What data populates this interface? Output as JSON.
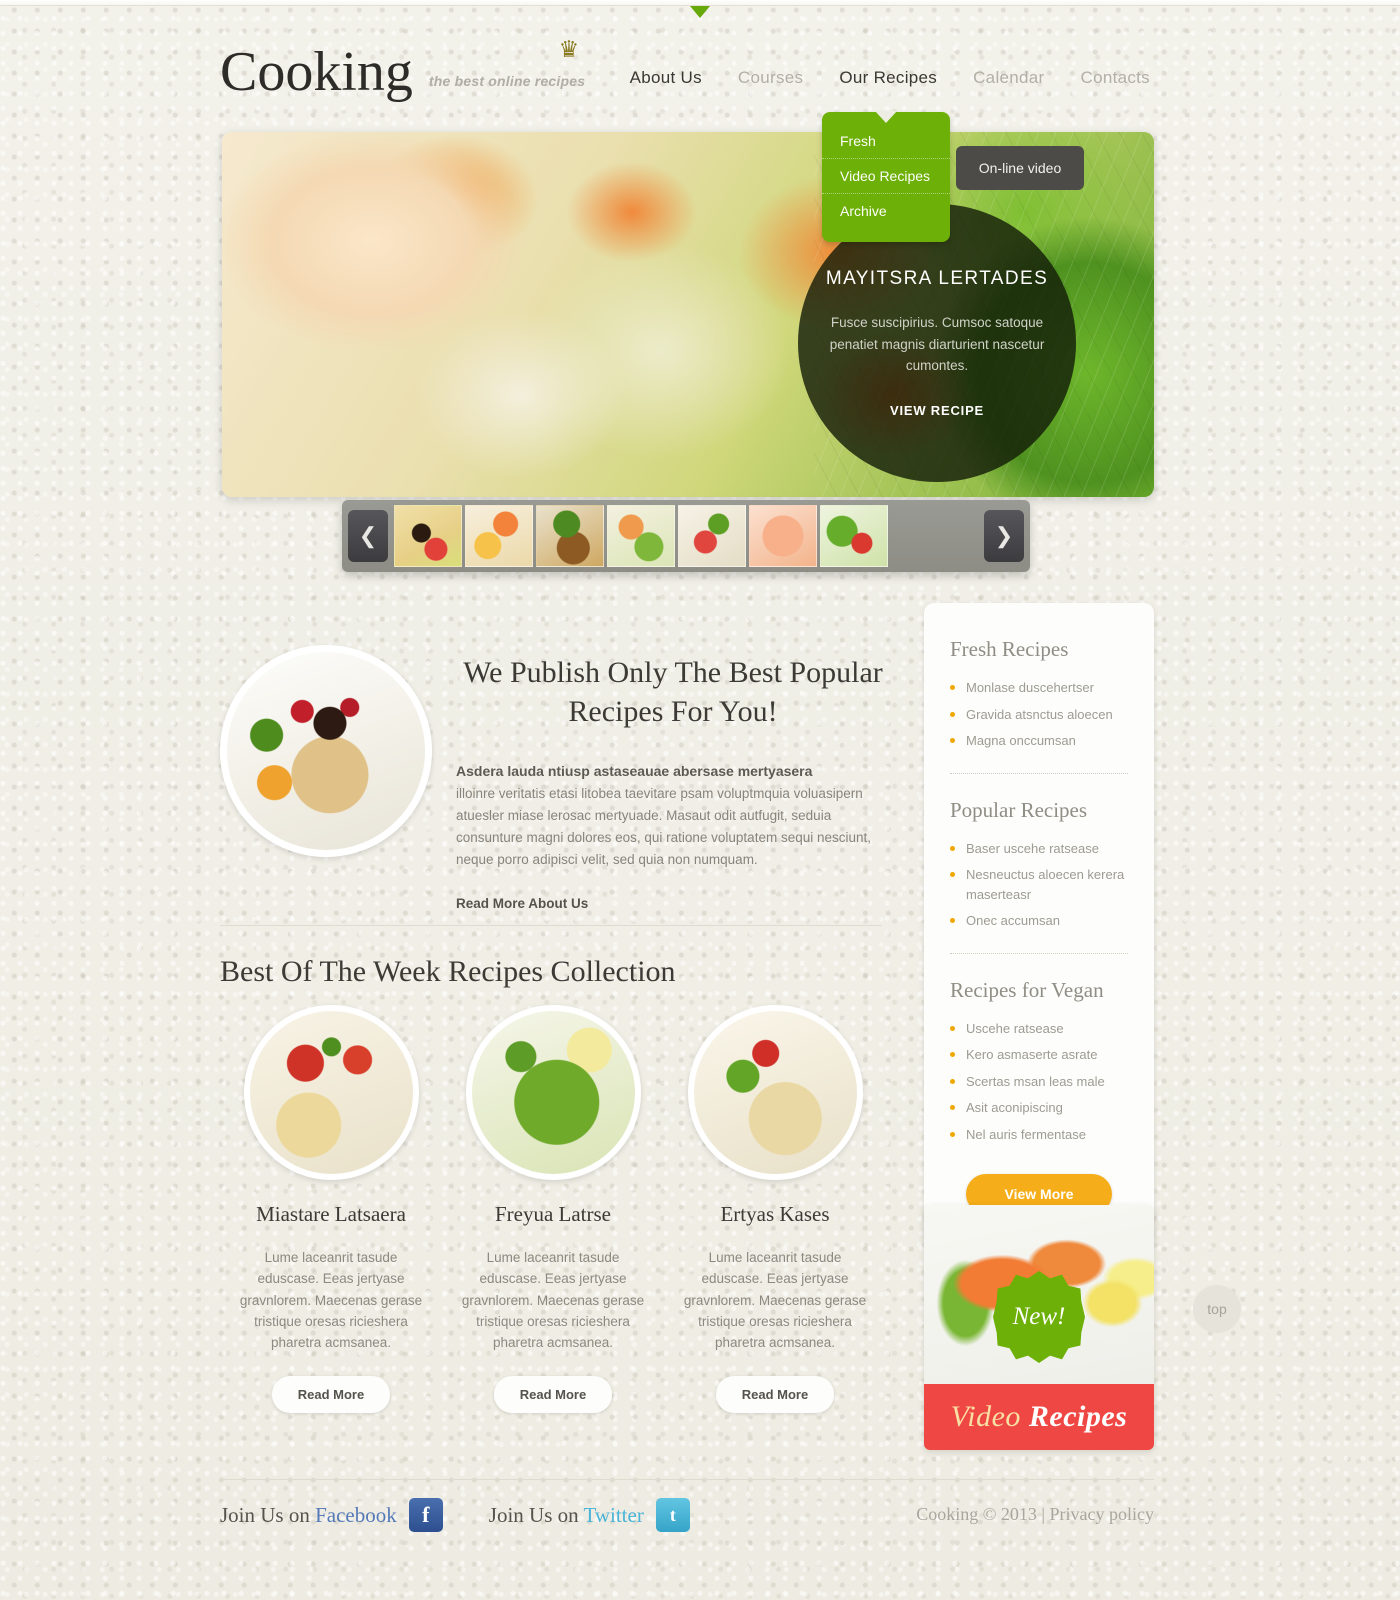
{
  "brand": {
    "name": "Cooking",
    "tagline": "the best online recipes",
    "crown_icon": "crown-icon"
  },
  "nav": {
    "items": [
      {
        "label": "About Us",
        "active": true
      },
      {
        "label": "Courses",
        "active": false
      },
      {
        "label": "Our Recipes",
        "active": true
      },
      {
        "label": "Calendar",
        "active": false
      },
      {
        "label": "Contacts",
        "active": false
      }
    ],
    "dropdown": {
      "items": [
        "Fresh",
        "Video Recipes",
        "Archive"
      ]
    },
    "flyout": {
      "label": "On-line video"
    }
  },
  "hero": {
    "title": "MAYITSRA LERTADES",
    "description": "Fusce suscipirius. Cumsoc satoque penatiet magnis diarturient nascetur cumontes.",
    "cta": "VIEW RECIPE"
  },
  "carousel": {
    "prev_icon": "chevron-left-icon",
    "next_icon": "chevron-right-icon",
    "thumb_count": 7
  },
  "about": {
    "heading": "We Publish Only The Best Popular Recipes For You!",
    "lead": "Asdera lauda ntiusp astaseauae abersase mertyasera",
    "body": "illoinre veritatis etasi litobea taevitare psam voluptmquia voluasipern atuesler miase lerosac mertyuade. Masaut odit autfugit, seduia consunture magni dolores eos, qui ratione voluptatem sequi nesciunt, neque porro adipisci velit, sed quia non numquam.",
    "link": "Read More About Us"
  },
  "week": {
    "title": "Best Of The Week Recipes Collection",
    "cards": [
      {
        "title": "Miastare Latsaera",
        "desc": "Lume laceanrit tasude eduscase. Eeas jertyase gravnlorem. Maecenas gerase tristique oresas ricieshera pharetra acmsanea.",
        "button": "Read More"
      },
      {
        "title": "Freyua Latrse",
        "desc": "Lume laceanrit tasude eduscase. Eeas jertyase gravnlorem. Maecenas gerase tristique oresas ricieshera pharetra acmsanea.",
        "button": "Read More"
      },
      {
        "title": "Ertyas Kases",
        "desc": "Lume laceanrit tasude eduscase. Eeas jertyase gravnlorem. Maecenas gerase tristique oresas ricieshera pharetra acmsanea.",
        "button": "Read More"
      }
    ]
  },
  "sidebar": {
    "blocks": [
      {
        "title": "Fresh Recipes",
        "items": [
          "Monlase duscehertser",
          "Gravida atsnctus aloecen",
          "Magna onccumsan"
        ]
      },
      {
        "title": "Popular Recipes",
        "items": [
          "Baser uscehe ratsease",
          "Nesneuctus aloecen kerera maserteasr",
          "Onec accumsan"
        ]
      },
      {
        "title": "Recipes for Vegan",
        "items": [
          "Uscehe ratsease",
          "Kero asmaserte asrate",
          "Scertas msan leas male",
          "Asit aconipiscing",
          "Nel auris fermentase"
        ]
      }
    ],
    "view_more": "View More"
  },
  "promo": {
    "badge": "New!",
    "title_1": "Video",
    "title_2": "Recipes"
  },
  "top_button": {
    "label": "top"
  },
  "footer": {
    "facebook_prefix": "Join Us on ",
    "facebook_name": "Facebook",
    "facebook_icon": "facebook-icon",
    "facebook_glyph": "f",
    "twitter_prefix": "Join Us on ",
    "twitter_name": "Twitter",
    "twitter_icon": "twitter-icon",
    "twitter_glyph": "t",
    "copyright": "Cooking © 2013  |  Privacy policy"
  },
  "colors": {
    "green": "#6db007",
    "orange": "#f5ad19",
    "red": "#ef4844",
    "dark": "#3c3a35",
    "muted": "#9d9b92"
  }
}
